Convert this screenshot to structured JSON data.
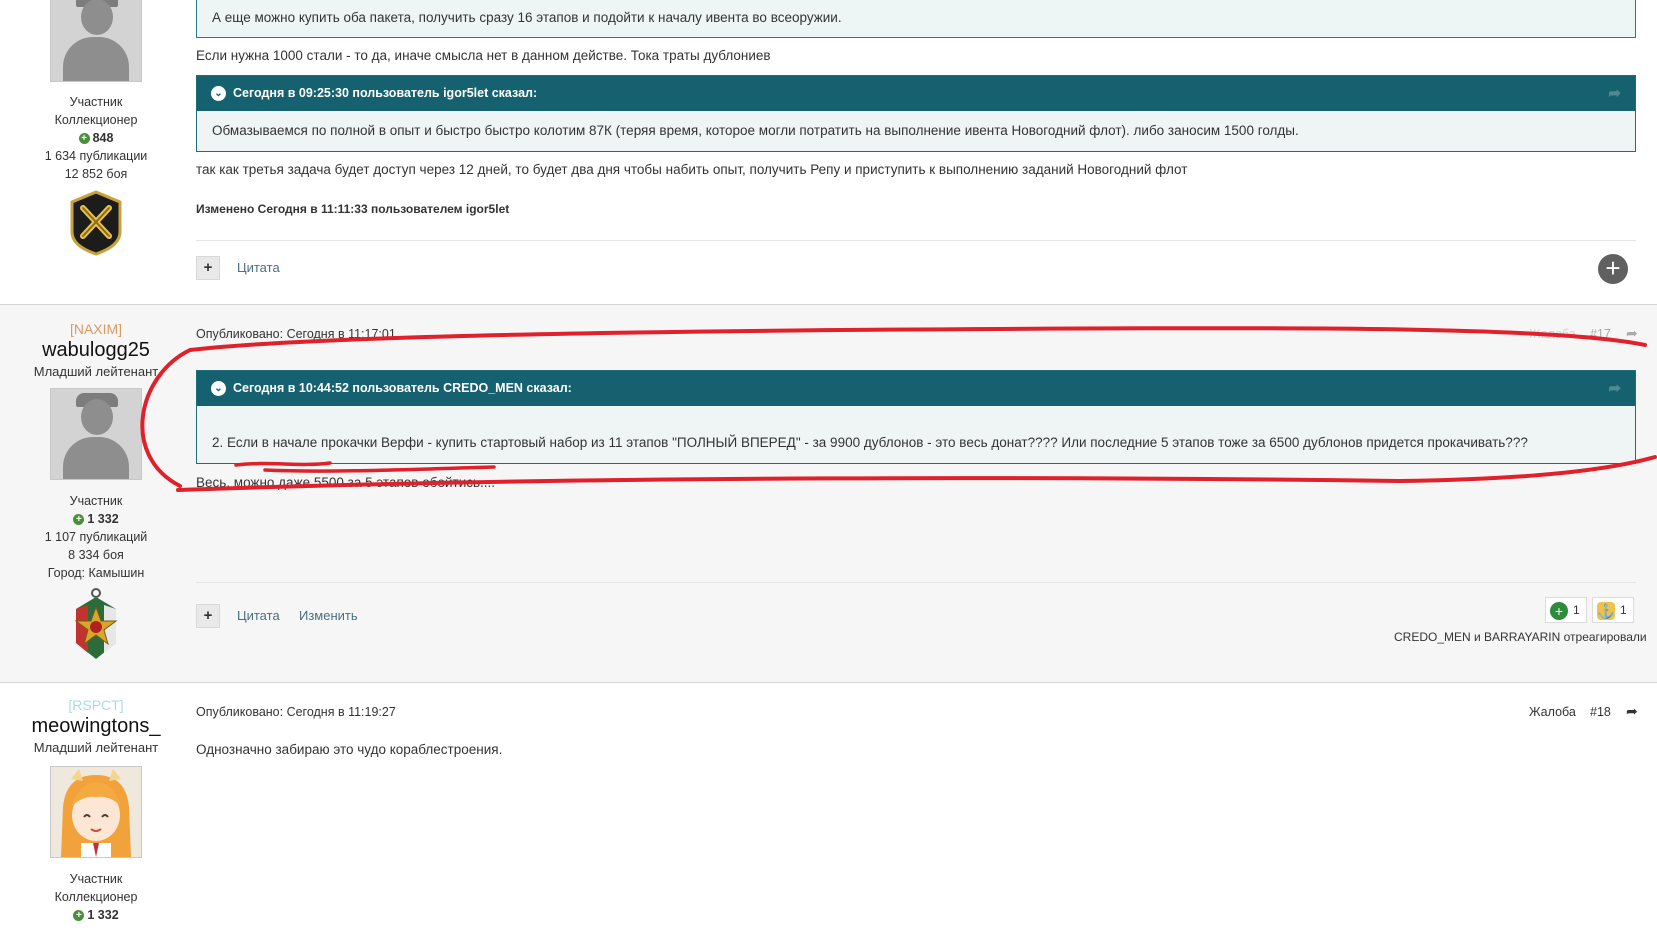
{
  "post1": {
    "author": {
      "group": "Участник",
      "title": "Коллекционер",
      "reputation": "848",
      "publications": "1 634 публикации",
      "battles": "12 852 боя"
    },
    "top_quote_text": "А еще можно купить оба пакета, получить сразу 16 этапов и подойти к началу ивента во всеоружии.",
    "text_1": "Если нужна 1000 стали - то да, иначе смысла нет в данном действе. Тока траты дублониев",
    "quote": {
      "header": "Сегодня в 09:25:30 пользователь igor5let сказал:",
      "body": "Обмазываемся по полной в опыт и быстро быстро колотим 87К (теряя время, которое могли потратить на выполнение ивента Новогодний флот). либо заносим 1500 голды."
    },
    "text_2": "так как третья задача будет доступ через 12 дней, то будет два дня чтобы набить опыт, получить Репу и приступить к выполнению заданий Новогодний флот",
    "edited": "Изменено Сегодня в 11:11:33 пользователем igor5let",
    "actions": {
      "plus": "+",
      "quote": "Цитата",
      "add": "+"
    }
  },
  "post2": {
    "author": {
      "clan": "[NAXIM]",
      "name": "wabulogg25",
      "rank": "Младший лейтенант",
      "group": "Участник",
      "reputation": "1 332",
      "publications": "1 107 публикаций",
      "battles": "8 334 боя",
      "city": "Город: Камышин"
    },
    "published": "Опубликовано: Сегодня в 11:17:01",
    "report": "Жалоба",
    "number": "#17",
    "quote": {
      "header": "Сегодня в 10:44:52 пользователь CREDO_MEN сказал:",
      "body": "2. Если в начале прокачки Верфи - купить стартовый набор из 11 этапов \"ПОЛНЫЙ ВПЕРЕД\" - за 9900 дублонов - это весь донат???? Или последние 5 этапов тоже за 6500 дублонов придется прокачивать???"
    },
    "text": "Весь, можно даже 5500 за 5 этапов обойтись....",
    "actions": {
      "plus": "+",
      "quote": "Цитата",
      "edit": "Изменить"
    },
    "reactions": [
      {
        "icon": "plus-reaction-icon",
        "count": "1"
      },
      {
        "icon": "captain-reaction-icon",
        "count": "1"
      }
    ],
    "reacted": "CREDO_MEN и BARRAYARIN отреагировали"
  },
  "post3": {
    "author": {
      "clan": "[RSPCT]",
      "name": "meowingtons_",
      "rank": "Младший лейтенант",
      "group": "Участник",
      "title": "Коллекционер",
      "reputation": "1 332"
    },
    "published": "Опубликовано: Сегодня в 11:19:27",
    "report": "Жалоба",
    "number": "#18",
    "text": "Однозначно забираю это чудо кораблестроения."
  },
  "colors": {
    "quote_header": "#16616f",
    "annotation": "#e0202a",
    "link": "#4a6f80"
  }
}
